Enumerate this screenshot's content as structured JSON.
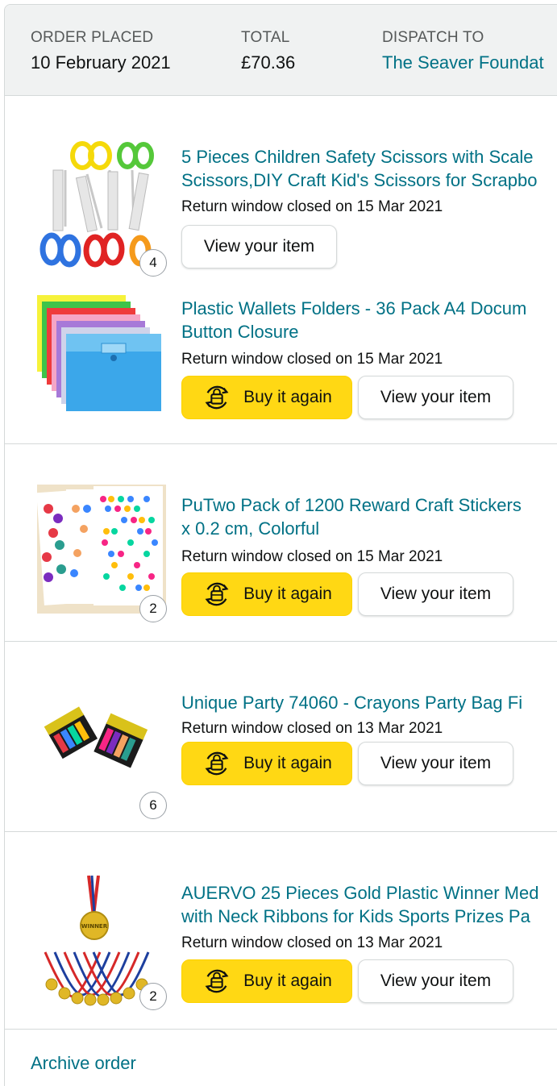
{
  "header": {
    "order_placed_label": "ORDER PLACED",
    "order_placed_value": "10 February 2021",
    "total_label": "TOTAL",
    "total_value": "£70.36",
    "dispatch_label": "DISPATCH TO",
    "dispatch_value": "The Seaver Foundat"
  },
  "items": [
    {
      "title_line1": "5 Pieces Children Safety Scissors with Scale",
      "title_line2": "Scissors,DIY Craft Kid's Scissors for Scrapbo",
      "status": "Return window closed on 15 Mar 2021",
      "quantity": "4",
      "view_label": "View your item",
      "thumbnail": "scissors-image"
    },
    {
      "title_line1": "Plastic Wallets Folders - 36 Pack A4 Docum",
      "title_line2": "Button Closure",
      "status": "Return window closed on 15 Mar 2021",
      "buy_label": "Buy it again",
      "view_label": "View your item",
      "thumbnail": "folders-image"
    },
    {
      "title_line1": "PuTwo Pack of 1200 Reward Craft Stickers",
      "title_line2": "x 0.2 cm, Colorful",
      "status": "Return window closed on 15 Mar 2021",
      "quantity": "2",
      "buy_label": "Buy it again",
      "view_label": "View your item",
      "thumbnail": "stickers-image"
    },
    {
      "title_line1": "Unique Party 74060 - Crayons Party Bag Fi",
      "status": "Return window closed on 13 Mar 2021",
      "quantity": "6",
      "buy_label": "Buy it again",
      "view_label": "View your item",
      "thumbnail": "crayons-image"
    },
    {
      "title_line1": "AUERVO 25 Pieces Gold Plastic Winner Med",
      "title_line2": "with Neck Ribbons for Kids Sports Prizes Pa",
      "status": "Return window closed on 13 Mar 2021",
      "quantity": "2",
      "buy_label": "Buy it again",
      "view_label": "View your item",
      "thumbnail": "medals-image",
      "medal_text": "WINNER"
    }
  ],
  "footer": {
    "archive_label": "Archive order"
  },
  "colors": {
    "link": "#007185",
    "buy_button": "#ffd814",
    "header_bg": "#f0f2f2",
    "border": "#d5d9d9"
  }
}
